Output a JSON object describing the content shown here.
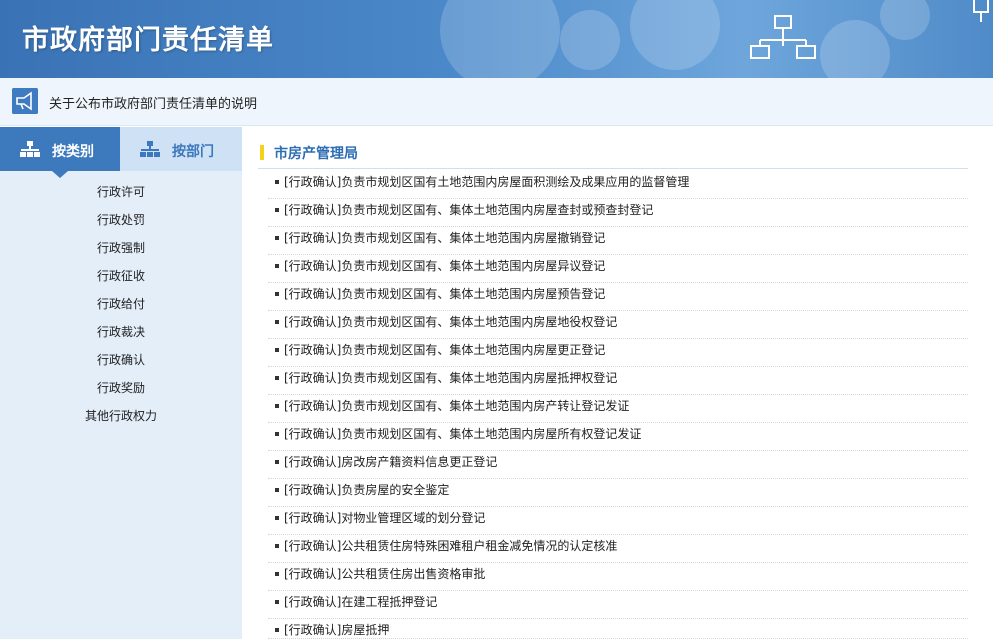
{
  "banner": {
    "title": "市政府部门责任清单"
  },
  "notice": {
    "text": "关于公布市政府部门责任清单的说明"
  },
  "tabs": [
    {
      "label": "按类别",
      "active": true
    },
    {
      "label": "按部门",
      "active": false
    }
  ],
  "categories": [
    "行政许可",
    "行政处罚",
    "行政强制",
    "行政征收",
    "行政给付",
    "行政裁决",
    "行政确认",
    "行政奖励",
    "其他行政权力"
  ],
  "department": {
    "name": "市房产管理局"
  },
  "items": [
    "[行政确认]负责市规划区国有土地范围内房屋面积测绘及成果应用的监督管理",
    "[行政确认]负责市规划区国有、集体土地范围内房屋查封或预查封登记",
    "[行政确认]负责市规划区国有、集体土地范围内房屋撤销登记",
    "[行政确认]负责市规划区国有、集体土地范围内房屋异议登记",
    "[行政确认]负责市规划区国有、集体土地范围内房屋预告登记",
    "[行政确认]负责市规划区国有、集体土地范围内房屋地役权登记",
    "[行政确认]负责市规划区国有、集体土地范围内房屋更正登记",
    "[行政确认]负责市规划区国有、集体土地范围内房屋抵押权登记",
    "[行政确认]负责市规划区国有、集体土地范围内房产转让登记发证",
    "[行政确认]负责市规划区国有、集体土地范围内房屋所有权登记发证",
    "[行政确认]房改房产籍资料信息更正登记",
    "[行政确认]负责房屋的安全鉴定",
    "[行政确认]对物业管理区域的划分登记",
    "[行政确认]公共租赁住房特殊困难租户租金减免情况的认定核准",
    "[行政确认]公共租赁住房出售资格审批",
    "[行政确认]在建工程抵押登记",
    "[行政确认]房屋抵押"
  ],
  "colors": {
    "brand": "#3d79bd",
    "leftBg": "#e3eef9",
    "accent": "#f2d21a"
  }
}
